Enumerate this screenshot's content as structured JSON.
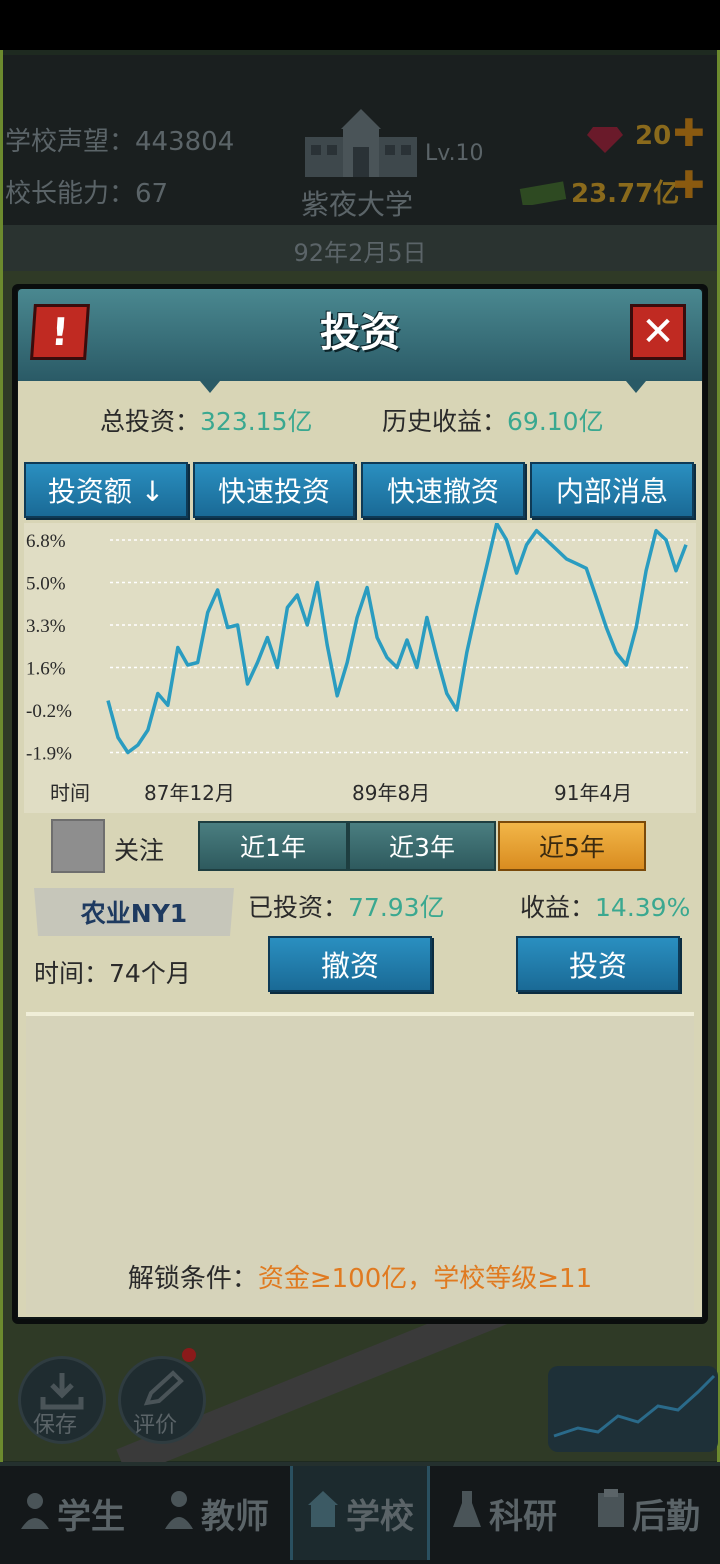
{
  "hud": {
    "reputation_label": "学校声望：",
    "reputation_value": "443804",
    "ability_label": "校长能力：",
    "ability_value": "67",
    "school_level": "Lv.10",
    "school_name": "紫夜大学",
    "gems": "20",
    "money": "23.77亿",
    "date": "92年2月5日"
  },
  "modal": {
    "title": "投资",
    "total_invest_label": "总投资：",
    "total_invest_value": "323.15亿",
    "history_profit_label": "历史收益：",
    "history_profit_value": "69.10亿",
    "tabs": [
      "投资额 ↓",
      "快速投资",
      "快速撤资",
      "内部消息"
    ],
    "follow_label": "关注",
    "periods": [
      "近1年",
      "近3年",
      "近5年"
    ],
    "active_period": "近5年",
    "fund_name": "农业NY1",
    "invested_label": "已投资：",
    "invested_value": "77.93亿",
    "return_label": "收益：",
    "return_value": "14.39%",
    "duration_label": "时间：",
    "duration_value": "74个月",
    "withdraw_button": "撤资",
    "invest_button": "投资",
    "unlock_label": "解锁条件：",
    "unlock_condition": "资金≥100亿，学校等级≥11"
  },
  "chart_data": {
    "type": "line",
    "xlabel": "时间",
    "x_tick_labels": [
      "87年12月",
      "89年8月",
      "91年4月"
    ],
    "y_tick_labels": [
      "6.8%",
      "5.0%",
      "3.3%",
      "1.6%",
      "-0.2%",
      "-1.9%"
    ],
    "ylim": [
      -2.4,
      6.8
    ],
    "grid": true,
    "line_color": "#2a9cc0",
    "values": [
      0.2,
      -1.3,
      -1.9,
      -1.6,
      -1.0,
      0.5,
      0.0,
      2.4,
      1.7,
      1.8,
      3.8,
      4.7,
      3.2,
      3.3,
      0.9,
      1.8,
      2.8,
      1.6,
      4.0,
      4.5,
      3.3,
      5.0,
      2.5,
      0.4,
      1.8,
      3.6,
      4.8,
      2.8,
      2.0,
      1.6,
      2.7,
      1.6,
      3.6,
      2.0,
      0.5,
      -0.2,
      2.2,
      4.0,
      5.7,
      7.5,
      6.8,
      5.4,
      6.6,
      7.2,
      6.8,
      6.4,
      6.0,
      5.8,
      5.6,
      4.4,
      3.2,
      2.2,
      1.7,
      3.2,
      5.5,
      7.2,
      6.8,
      5.5,
      6.6
    ]
  },
  "nav": {
    "save": "保存",
    "rate": "评价",
    "items": [
      "学生",
      "教师",
      "学校",
      "科研",
      "后勤"
    ]
  },
  "colors": {
    "accent_blue": "#1a6a96",
    "positive_value": "#3aa890",
    "unlock_orange": "#e07a20",
    "close_red": "#c02a22"
  }
}
